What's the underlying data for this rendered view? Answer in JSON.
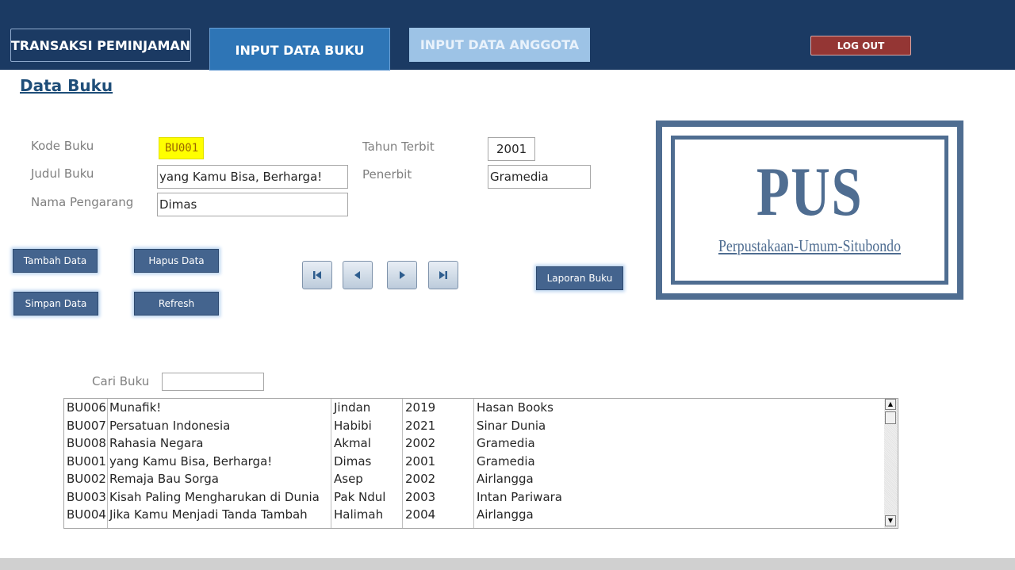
{
  "tabs": {
    "transaksi": "TRANSAKSI PEMINJAMAN",
    "buku": "INPUT DATA BUKU",
    "anggota": "INPUT DATA ANGGOTA"
  },
  "logout_label": "LOG OUT",
  "page_title": "Data Buku",
  "form": {
    "kode_label": "Kode Buku",
    "kode_value": "BU001",
    "judul_label": "Judul Buku",
    "judul_value": "yang Kamu Bisa, Berharga!",
    "pengarang_label": "Nama Pengarang",
    "pengarang_value": "Dimas",
    "tahun_label": "Tahun Terbit",
    "tahun_value": "2001",
    "penerbit_label": "Penerbit",
    "penerbit_value": "Gramedia"
  },
  "buttons": {
    "tambah": "Tambah Data",
    "hapus": "Hapus Data",
    "simpan": "Simpan Data",
    "refresh": "Refresh",
    "laporan": "Laporan Buku"
  },
  "navigation": [
    "first-record-icon",
    "previous-record-icon",
    "next-record-icon",
    "last-record-icon"
  ],
  "logo": {
    "title": "PUS",
    "subtitle": "Perpustakaan-Umum-Situbondo"
  },
  "search": {
    "label": "Cari Buku",
    "value": ""
  },
  "book_list": [
    {
      "kode": "BU006",
      "judul": "Munafik!",
      "pengarang": "Jindan",
      "tahun": "2019",
      "penerbit": "Hasan Books"
    },
    {
      "kode": "BU007",
      "judul": "Persatuan Indonesia",
      "pengarang": "Habibi",
      "tahun": "2021",
      "penerbit": "Sinar Dunia"
    },
    {
      "kode": "BU008",
      "judul": "Rahasia Negara",
      "pengarang": "Akmal",
      "tahun": "2002",
      "penerbit": "Gramedia"
    },
    {
      "kode": "BU001",
      "judul": "yang Kamu Bisa, Berharga!",
      "pengarang": "Dimas",
      "tahun": "2001",
      "penerbit": "Gramedia"
    },
    {
      "kode": "BU002",
      "judul": "Remaja Bau Sorga",
      "pengarang": "Asep",
      "tahun": "2002",
      "penerbit": "Airlangga"
    },
    {
      "kode": "BU003",
      "judul": "Kisah Paling Mengharukan di Dunia",
      "pengarang": "Pak Ndul",
      "tahun": "2003",
      "penerbit": "Intan Pariwara"
    },
    {
      "kode": "BU004",
      "judul": "Jika Kamu Menjadi Tanda Tambah",
      "pengarang": "Halimah",
      "tahun": "2004",
      "penerbit": "Airlangga"
    }
  ],
  "colors": {
    "topbar": "#1b3a63",
    "active_tab": "#2e75b6",
    "inactive_tab": "#9dc3e6",
    "logout": "#943634",
    "button": "#44648e",
    "logo": "#4f6d91",
    "highlight": "#ffff00"
  }
}
